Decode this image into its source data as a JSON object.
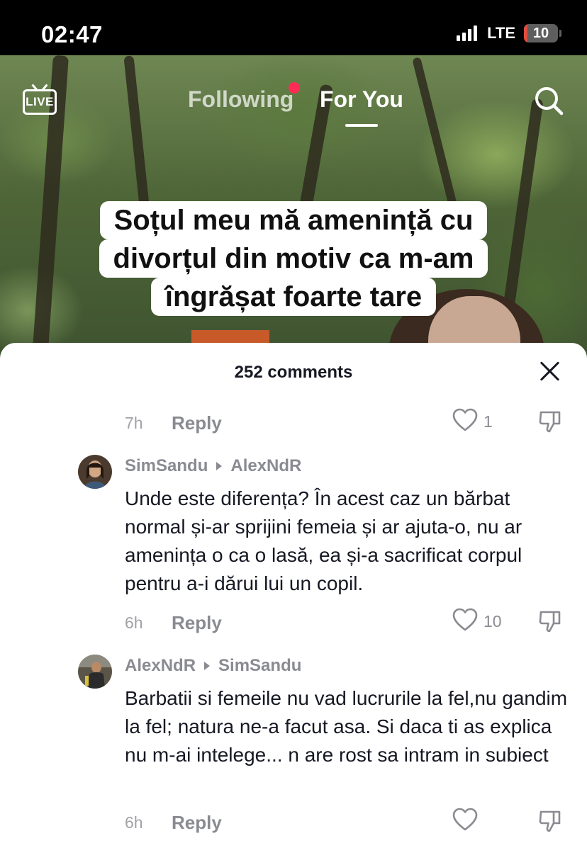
{
  "status_bar": {
    "time": "02:47",
    "network": "LTE",
    "battery": "10",
    "battery_level": 0.1
  },
  "top_nav": {
    "live_label": "LIVE",
    "tab_following": "Following",
    "tab_for_you": "For You",
    "search_icon": "search-icon"
  },
  "video": {
    "caption_lines": [
      "Soțul meu mă amenință cu",
      "divorțul din motiv ca m-am",
      "îngrășat foarte tare"
    ]
  },
  "comments_sheet": {
    "title": "252 comments",
    "close_icon": "close-icon",
    "first_meta": {
      "time": "7h",
      "reply": "Reply",
      "likes": "1"
    },
    "comments": [
      {
        "author": "SimSandu",
        "reply_to": "AlexNdR",
        "text": "Unde este diferența? În acest caz un bărbat normal și-ar sprijini femeia și ar ajuta-o, nu ar amenința o ca o lasă, ea și-a sacrificat corpul pentru a-i dărui lui un copil.",
        "time": "6h",
        "reply": "Reply",
        "likes": "10"
      },
      {
        "author": "AlexNdR",
        "reply_to": "SimSandu",
        "text": "Barbatii si femeile nu vad lucrurile la fel,nu gandim la fel; natura ne-a facut asa. Si daca ti as explica nu m-ai intelege... n are rost sa intram in subiect",
        "time": "6h",
        "reply": "Reply",
        "likes": ""
      }
    ]
  },
  "colors": {
    "accent_red": "#fe2c55",
    "text_primary": "#161823",
    "text_secondary": "#8a8b91"
  }
}
